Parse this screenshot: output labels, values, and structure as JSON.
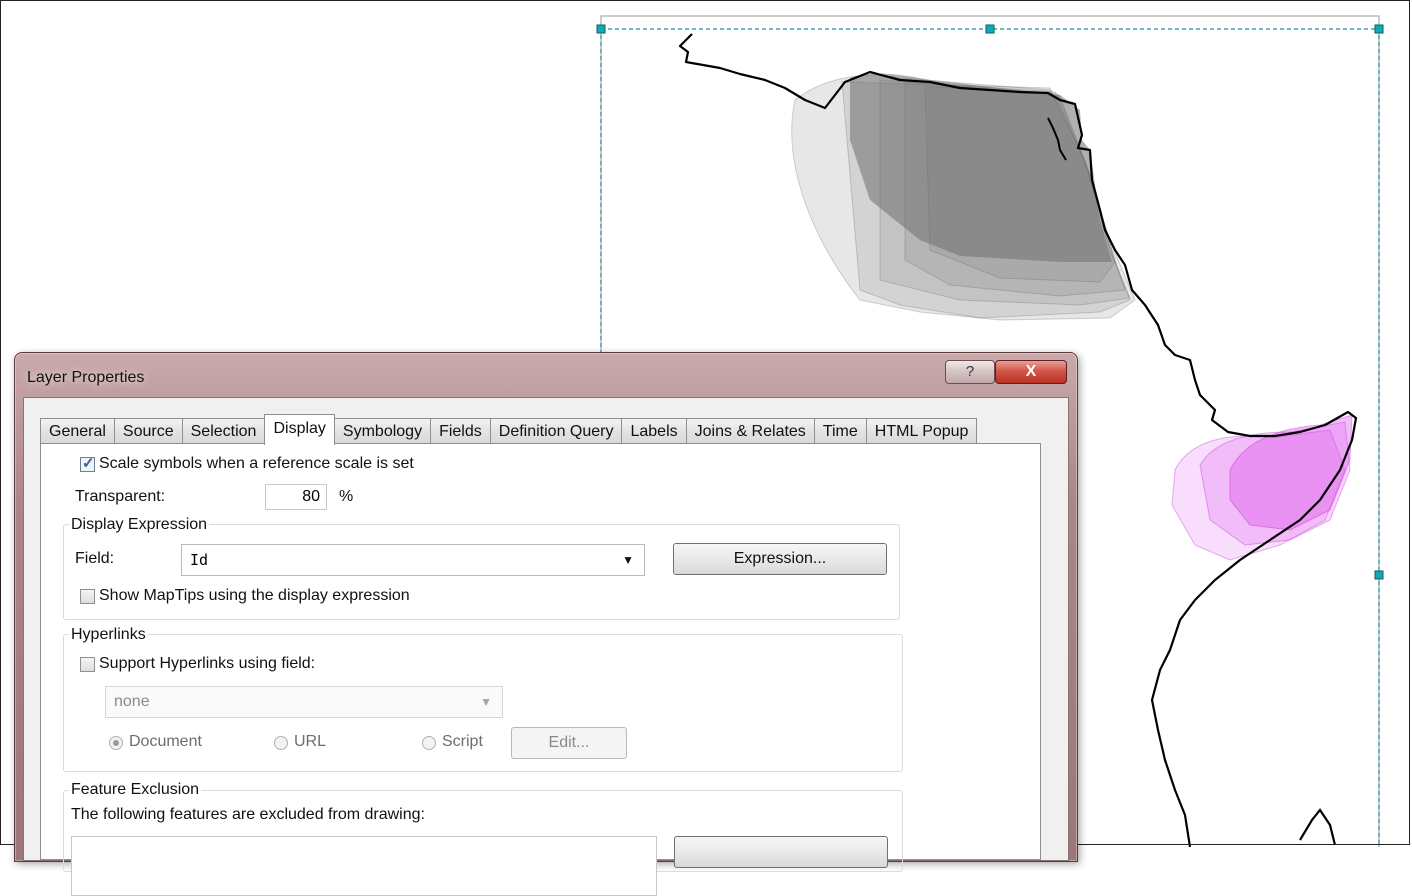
{
  "colors": {
    "land_fill": "#7a7a7a",
    "highlight_fill": "#d946ef",
    "outline": "#000000",
    "selection_handle": "#11a9b5"
  },
  "dialog": {
    "title": "Layer Properties",
    "help_icon": "?",
    "close_icon": "X",
    "tabs": [
      {
        "label": "General"
      },
      {
        "label": "Source"
      },
      {
        "label": "Selection"
      },
      {
        "label": "Display",
        "active": true
      },
      {
        "label": "Symbology"
      },
      {
        "label": "Fields"
      },
      {
        "label": "Definition Query"
      },
      {
        "label": "Labels"
      },
      {
        "label": "Joins & Relates"
      },
      {
        "label": "Time"
      },
      {
        "label": "HTML Popup"
      }
    ],
    "display": {
      "scale_symbols": {
        "label": "Scale symbols when a reference scale is set",
        "checked": true
      },
      "transparent": {
        "label": "Transparent:",
        "value": "80",
        "unit": "%"
      },
      "display_expression": {
        "title": "Display Expression",
        "field_label": "Field:",
        "field_value": "Id",
        "expression_button": "Expression...",
        "show_maptips": {
          "label": "Show MapTips using the display expression",
          "checked": false
        }
      },
      "hyperlinks": {
        "title": "Hyperlinks",
        "support": {
          "label": "Support Hyperlinks using field:",
          "checked": false
        },
        "field_value": "none",
        "radio_document": "Document",
        "radio_url": "URL",
        "radio_script": "Script",
        "selected_radio": "Document",
        "edit_button": "Edit..."
      },
      "feature_exclusion": {
        "title": "Feature Exclusion",
        "description": "The following features are excluded from drawing:"
      }
    }
  }
}
